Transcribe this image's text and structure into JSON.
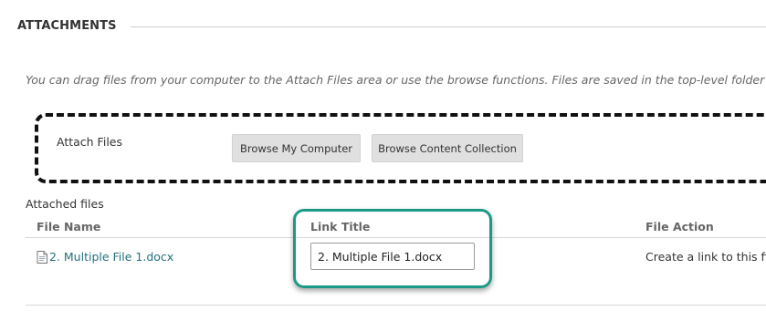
{
  "section": {
    "title": "ATTACHMENTS",
    "instructions": "You can drag files from your computer to the Attach Files area or use the browse functions. Files are saved in the top-level folder in your c"
  },
  "attach": {
    "label": "Attach Files",
    "browse_computer": "Browse My Computer",
    "browse_collection": "Browse Content Collection"
  },
  "attached": {
    "label": "Attached files",
    "columns": {
      "file_name": "File Name",
      "link_title": "Link Title",
      "file_action": "File Action"
    },
    "rows": [
      {
        "file_name": "2. Multiple File 1.docx",
        "link_title": "2. Multiple File 1.docx",
        "file_action": "Create a link to this file"
      }
    ]
  },
  "colors": {
    "link": "#23707d",
    "highlight": "#1a9a86",
    "button_bg": "#e0e0e0"
  },
  "icons": {
    "file": "document-icon"
  }
}
